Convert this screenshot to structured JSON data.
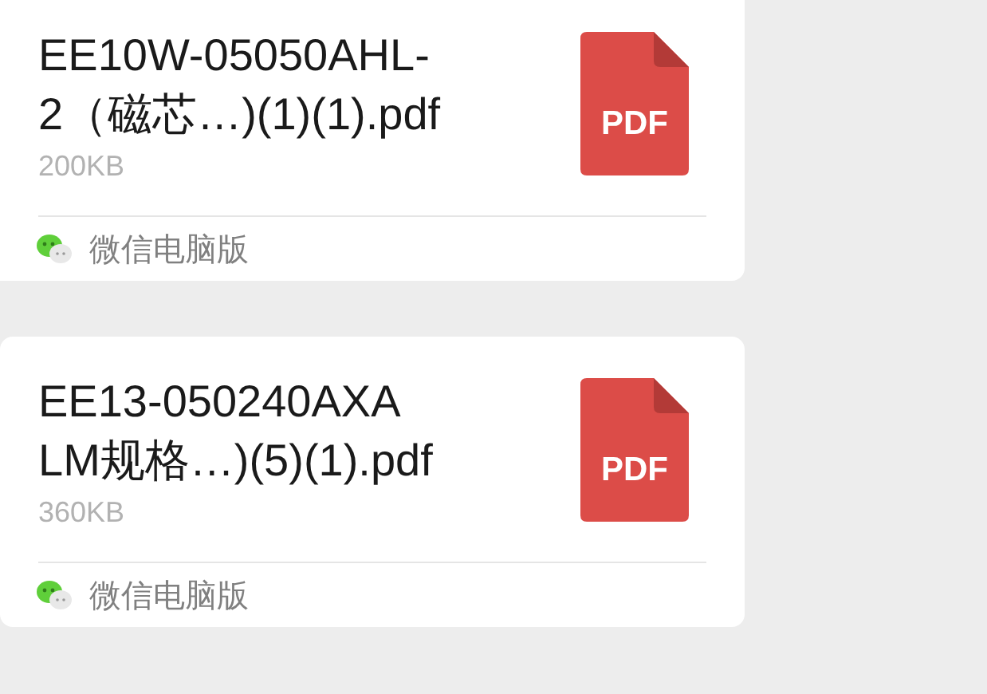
{
  "messages": [
    {
      "kind": "file",
      "title": "EE10W-05050AHL-\n2（磁芯…)(1)(1).pdf",
      "file_type": "PDF",
      "size": "200KB",
      "source": "微信电脑版"
    },
    {
      "kind": "file",
      "title": "EE13-050240AXA\nLM规格…)(5)(1).pdf",
      "file_type": "PDF",
      "size": "360KB",
      "source": "微信电脑版"
    }
  ]
}
